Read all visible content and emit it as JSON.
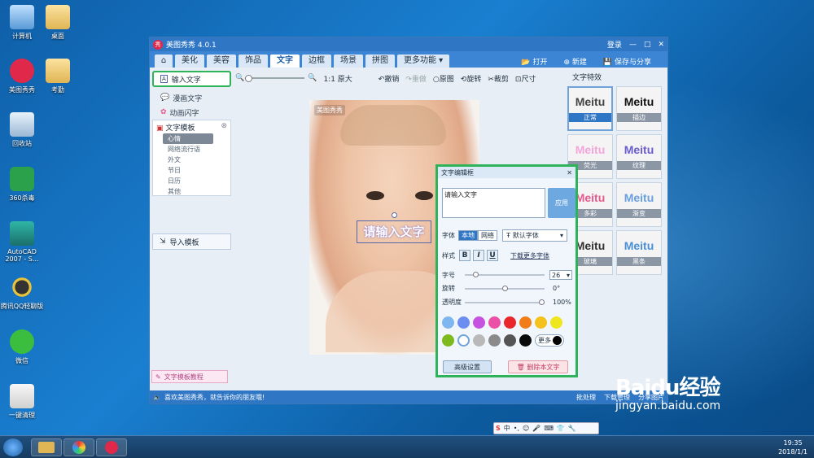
{
  "desktop": {
    "icons": [
      {
        "label": "计算机"
      },
      {
        "label": "桌面"
      },
      {
        "label": "美图秀秀"
      },
      {
        "label": "考勤"
      },
      {
        "label": "回收站"
      },
      {
        "label": "360杀毒"
      },
      {
        "label": "AutoCAD 2007 - S..."
      },
      {
        "label": "腾讯QQ轻聊版"
      },
      {
        "label": "微信"
      },
      {
        "label": "一键清理"
      }
    ]
  },
  "window": {
    "title": "美图秀秀 4.0.1",
    "title_controls": {
      "login": "登录",
      "min": "—",
      "max": "□",
      "close": "✕"
    },
    "tabs": [
      {
        "label": "美化"
      },
      {
        "label": "美容"
      },
      {
        "label": "饰品"
      },
      {
        "label": "文字",
        "active": true
      },
      {
        "label": "边框"
      },
      {
        "label": "场景"
      },
      {
        "label": "拼图"
      },
      {
        "label": "更多功能 ▾"
      }
    ],
    "top_actions": {
      "open": "打开",
      "new": "新建",
      "save": "保存与分享"
    }
  },
  "sidebar": {
    "input_text": "输入文字",
    "comic_text": "漫画文字",
    "anim_text": "动画闪字",
    "template_head": "文字模板",
    "template_items": [
      "心情",
      "网络流行语",
      "外文",
      "节日",
      "日历",
      "其他"
    ],
    "import_template": "导入模板",
    "tutorial": "文字模板教程"
  },
  "toolbar": {
    "original_size": "1:1 原大",
    "undo": "撤销",
    "redo": "重做",
    "original": "原图",
    "rotate": "旋转",
    "crop": "裁剪",
    "size": "尺寸"
  },
  "canvas": {
    "watermark": "美图秀秀",
    "text_box": "请输入文字"
  },
  "effects": {
    "title": "文字特效",
    "items": [
      {
        "label": "正常",
        "sample": "Meitu",
        "color": "#444444"
      },
      {
        "label": "描边",
        "sample": "Meitu",
        "color": "#111111"
      },
      {
        "label": "荧光",
        "sample": "Meitu",
        "color": "#f4a6dc"
      },
      {
        "label": "纹理",
        "sample": "Meitu",
        "color": "#6a5ccf"
      },
      {
        "label": "多彩",
        "sample": "Meitu",
        "color": "#e65a8c"
      },
      {
        "label": "渐变",
        "sample": "Meitu",
        "color": "#6aa0e0"
      },
      {
        "label": "玻璃",
        "sample": "Meitu",
        "color": "#333333"
      },
      {
        "label": "黑条",
        "sample": "Meitu",
        "color": "#4a90d9"
      }
    ]
  },
  "dialog": {
    "title": "文字编辑框",
    "text_value": "请输入文字",
    "apply": "应用",
    "font_label": "字体",
    "font_local": "本地",
    "font_network": "网络",
    "font_value": "默认字体",
    "style_label": "样式",
    "download_more": "下载更多字体",
    "size_label": "字号",
    "size_value": "26",
    "rotate_label": "旋转",
    "rotate_value": "0°",
    "opacity_label": "透明度",
    "opacity_value": "100%",
    "colors_row1": [
      "#7fb6f0",
      "#6c8ef0",
      "#c552e0",
      "#ec4fa6",
      "#e8262b",
      "#f07d18",
      "#f5c11c",
      "#f0e61d"
    ],
    "colors_row2": [
      "#7cba1e",
      "#ffffff",
      "#b9b9b9",
      "#8a8a8a",
      "#555555",
      "#0a0a0a"
    ],
    "more": "更多",
    "advanced": "高级设置",
    "delete": "删除本文字"
  },
  "statusbar": {
    "message": "喜欢美图秀秀，就告诉你的朋友哦!",
    "batch": "批处理",
    "download": "下载管理",
    "share": "分享图片"
  },
  "taskbar": {
    "time": "19:35",
    "date": "2018/1/1"
  },
  "watermark": {
    "brand": "Baidu经验",
    "url": "jingyan.baidu.com"
  }
}
